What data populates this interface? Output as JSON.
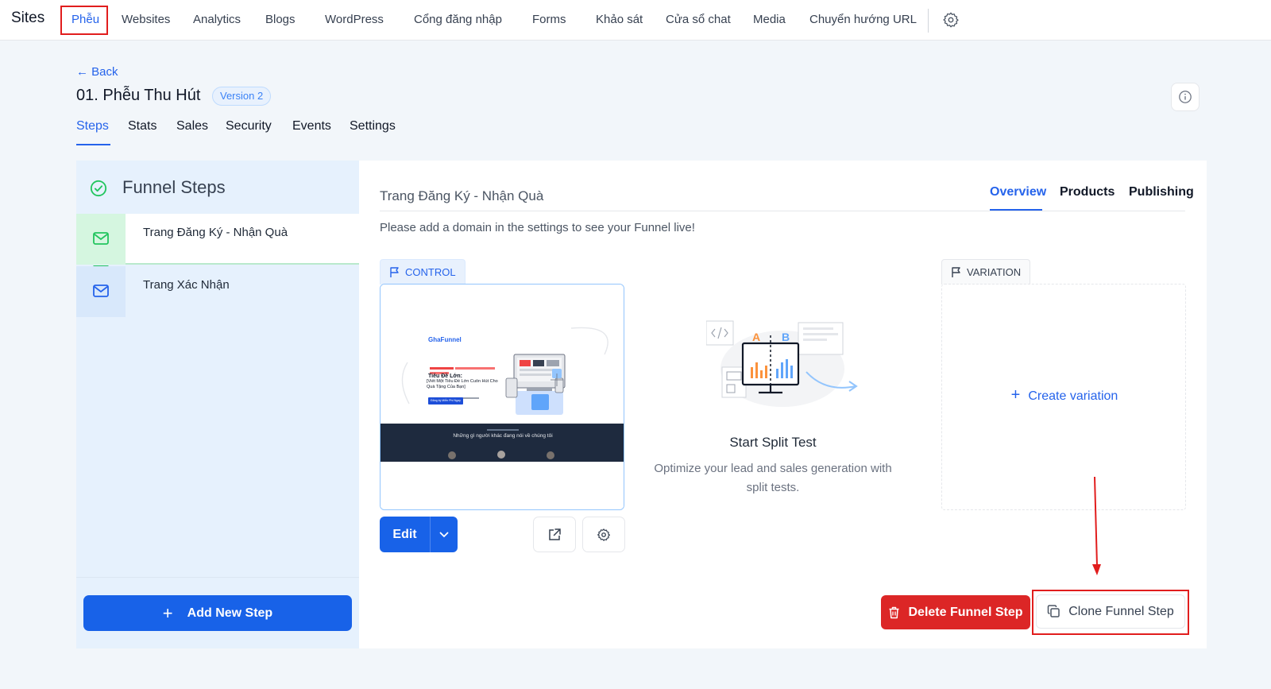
{
  "topnav": {
    "brand": "Sites",
    "items": [
      "Phễu",
      "Websites",
      "Analytics",
      "Blogs",
      "WordPress",
      "Cổng đăng nhập",
      "Forms",
      "Khảo sát",
      "Cửa sổ chat",
      "Media",
      "Chuyển hướng URL"
    ],
    "active_item": "Phễu",
    "settings_icon": "gear-icon"
  },
  "header": {
    "back_label": "Back",
    "title": "01. Phễu Thu Hút",
    "version_badge": "Version 2",
    "info_icon": "info-icon"
  },
  "tabs": {
    "items": [
      "Steps",
      "Stats",
      "Sales",
      "Security",
      "Events",
      "Settings"
    ],
    "active": "Steps"
  },
  "sidebar": {
    "title": "Funnel Steps",
    "steps": [
      {
        "label": "Trang Đăng Ký - Nhận Quà",
        "icon": "mail-icon",
        "selected": true
      },
      {
        "label": "Trang Xác Nhận",
        "icon": "mail-icon",
        "selected": false
      }
    ],
    "add_button_label": "Add New Step"
  },
  "main": {
    "step_title": "Trang Đăng Ký - Nhận Quà",
    "tabs": [
      "Overview",
      "Products",
      "Publishing"
    ],
    "active_tab": "Overview",
    "notice": "Please add a domain in the settings to see your Funnel live!",
    "control": {
      "label": "CONTROL",
      "preview": {
        "logo": "GhaFunnel",
        "headline": "Tiêu Đề Lớn:",
        "headline_sub": "[Viết Một Tiêu Đề Lớn Cuốn Hút Cho Quà Tặng Của Bạn]",
        "button": "Đăng ký Miễn Phí Ngay",
        "band_text": "Những gì người khác đang nói về chúng tôi"
      },
      "edit_label": "Edit"
    },
    "split_test": {
      "title": "Start Split Test",
      "subtitle": "Optimize your lead and sales generation with split tests."
    },
    "variation": {
      "label": "VARIATION",
      "create_label": "Create variation"
    },
    "delete_label": "Delete Funnel Step",
    "clone_label": "Clone Funnel Step"
  },
  "colors": {
    "accent": "#2563eb",
    "danger": "#dc2626",
    "highlight": "#e11d1d",
    "success": "#22c55e"
  }
}
